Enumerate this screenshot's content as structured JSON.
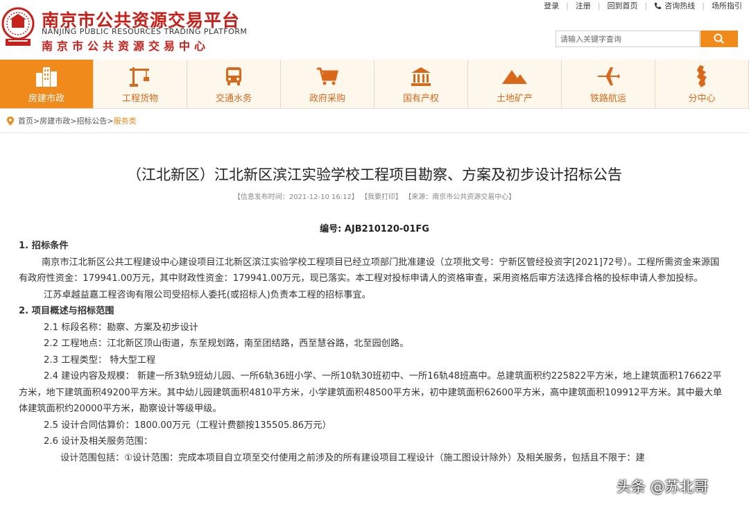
{
  "header": {
    "brand_cn": "南京市公共资源交易平台",
    "brand_en": "NANJING PUBLIC RESOURCES TRADING PLATFORM",
    "brand_sub": "南京市公共资源交易中心",
    "top_links": [
      "登录",
      "注册",
      "回到首页",
      "咨询热线",
      "场所指引"
    ],
    "search_placeholder": "请输入关键字查询"
  },
  "nav": [
    {
      "label": "房建市政",
      "icon": "building-icon",
      "active": true
    },
    {
      "label": "工程货物",
      "icon": "crane-icon",
      "active": false
    },
    {
      "label": "交通水务",
      "icon": "bus-icon",
      "active": false
    },
    {
      "label": "政府采购",
      "icon": "cart-icon",
      "active": false
    },
    {
      "label": "国有产权",
      "icon": "bank-icon",
      "active": false
    },
    {
      "label": "土地矿产",
      "icon": "mountain-icon",
      "active": false
    },
    {
      "label": "铁路航运",
      "icon": "airplane-icon",
      "active": false
    },
    {
      "label": "分中心",
      "icon": "map-icon",
      "active": false
    }
  ],
  "breadcrumb": [
    "首页",
    "房建市政",
    "招标公告",
    "服务类"
  ],
  "article": {
    "title": "（江北新区）江北新区滨江实验学校工程项目勘察、方案及初步设计招标公告",
    "meta": {
      "publish": "【信息发布时间：2021-12-10 16:12】",
      "print": "【我要打印】",
      "source": "【来源：南京市公共资源交易中心】"
    },
    "serial": "编号: AJB210120-01FG",
    "s1_title": "1. 招标条件",
    "s1_p1": "南京市江北新区公共工程建设中心建设项目江北新区滨江实验学校工程项目已经立项部门批准建设（立项批文号：宁新区管经投资字[2021]72号）。工程所需资金来源国有政府性资金：179941.00万元，其中财政性资金：179941.00万元，现已落实。本工程对投标申请人的资格审查，采用资格后审方法选择合格的投标申请人参加投标。",
    "s1_p2": "江苏卓越益嘉工程咨询有限公司受招标人委托(或招标人)负责本工程的招标事宜。",
    "s2_title": "2. 项目概述与招标范围",
    "s2_1": "2.1 标段名称：勘察、方案及初步设计",
    "s2_2": "2.2 工程地点：江北新区顶山街道，东至规划路，南至团结路，西至慧谷路，北至园创路。",
    "s2_3": "2.3 工程类型： 特大型工程",
    "s2_4": "2.4 建设内容及规模： 新建一所3轨9班幼儿园、一所6轨36班小学、一所10轨30班初中、一所16轨48班高中。总建筑面积约225822平方米，地上建筑面积176622平方米，地下建筑面积49200平方米。其中幼儿园建筑面积4810平方米，小学建筑面积48500平方米，初中建筑面积62600平方米，高中建筑面积109912平方米。其中最大单体建筑面积约20000平方米，勘察设计等级甲级。",
    "s2_5": "2.5 设计合同估算价：1800.00万元（工程计费额按135505.86万元）",
    "s2_6": "2.6 设计及相关服务范围：",
    "s2_6_p": "设计范围包括：①设计范围：完成本项目自立项至交付使用之前涉及的所有建设项目工程设计（施工图设计除外）及相关服务，包括且不限于：建"
  },
  "watermark": "头条 @苏北哥"
}
